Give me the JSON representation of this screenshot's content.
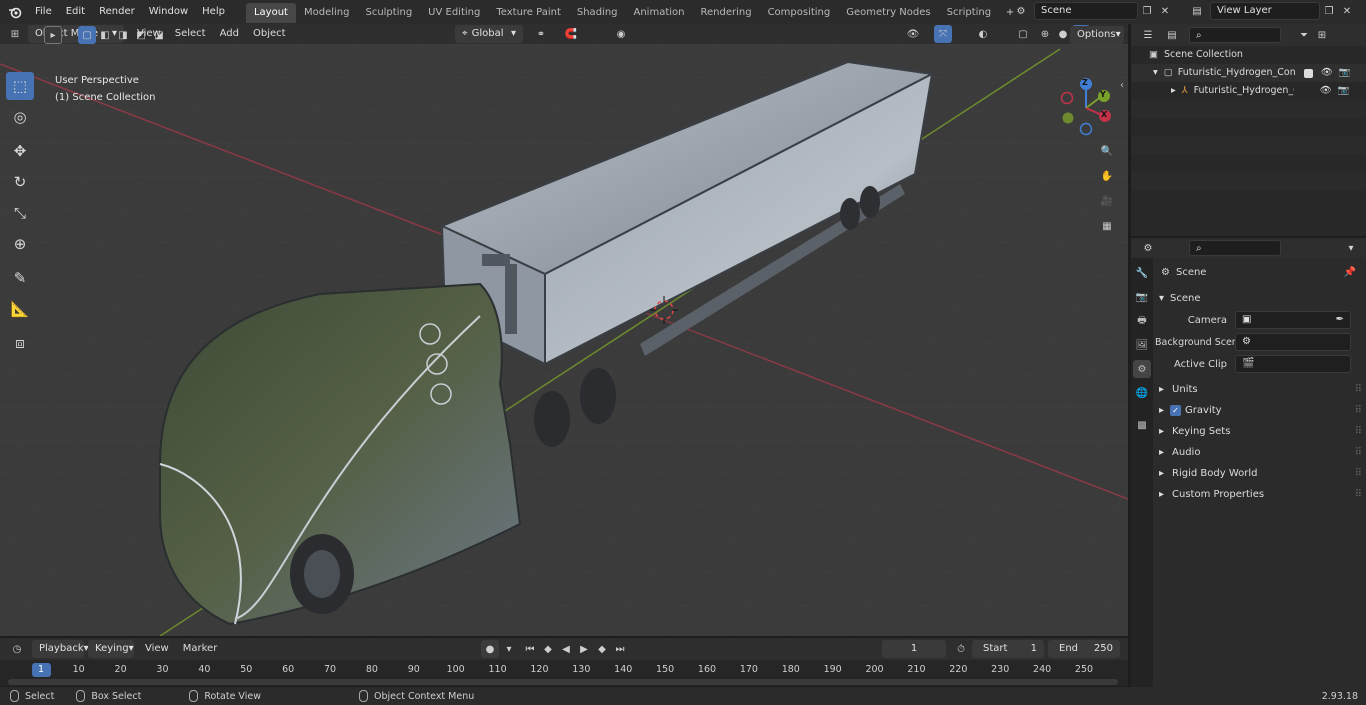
{
  "topbar": {
    "menus": [
      "File",
      "Edit",
      "Render",
      "Window",
      "Help"
    ],
    "workspaces": [
      "Layout",
      "Modeling",
      "Sculpting",
      "UV Editing",
      "Texture Paint",
      "Shading",
      "Animation",
      "Rendering",
      "Compositing",
      "Geometry Nodes",
      "Scripting"
    ],
    "active_workspace": "Layout",
    "scene_name": "Scene",
    "view_layer": "View Layer"
  },
  "viewport": {
    "mode": "Object Mode",
    "menus": [
      "View",
      "Select",
      "Add",
      "Object"
    ],
    "orientation": "Global",
    "options_label": "Options",
    "perspective_label": "User Perspective",
    "collection_label": "(1) Scene Collection",
    "gizmo_axes": [
      "Z",
      "Y",
      "X"
    ]
  },
  "outliner": {
    "root": "Scene Collection",
    "items": [
      {
        "name": "Futuristic_Hydrogen_Concept"
      },
      {
        "name": "Futuristic_Hydrogen_Con"
      }
    ]
  },
  "properties": {
    "context_title": "Scene",
    "panel_title": "Scene",
    "fields": [
      {
        "label": "Camera",
        "value": ""
      },
      {
        "label": "Background Scene",
        "value": ""
      },
      {
        "label": "Active Clip",
        "value": ""
      }
    ],
    "sections": [
      "Units",
      "Gravity",
      "Keying Sets",
      "Audio",
      "Rigid Body World",
      "Custom Properties"
    ],
    "gravity_checked": true
  },
  "timeline": {
    "menus": [
      "Playback",
      "Keying",
      "View",
      "Marker"
    ],
    "current_frame": "1",
    "start_label": "Start",
    "start_value": "1",
    "end_label": "End",
    "end_value": "250",
    "ticks": [
      "1",
      "10",
      "20",
      "30",
      "40",
      "50",
      "60",
      "70",
      "80",
      "90",
      "100",
      "110",
      "120",
      "130",
      "140",
      "150",
      "160",
      "170",
      "180",
      "190",
      "200",
      "210",
      "220",
      "230",
      "240",
      "250"
    ]
  },
  "statusbar": {
    "select": "Select",
    "box_select": "Box Select",
    "rotate_view": "Rotate View",
    "context_menu": "Object Context Menu",
    "version": "2.93.18"
  },
  "colors": {
    "accent": "#4772b3",
    "x_axis": "#c4324a",
    "y_axis": "#7aa02c",
    "z_axis": "#3f7fd6"
  }
}
